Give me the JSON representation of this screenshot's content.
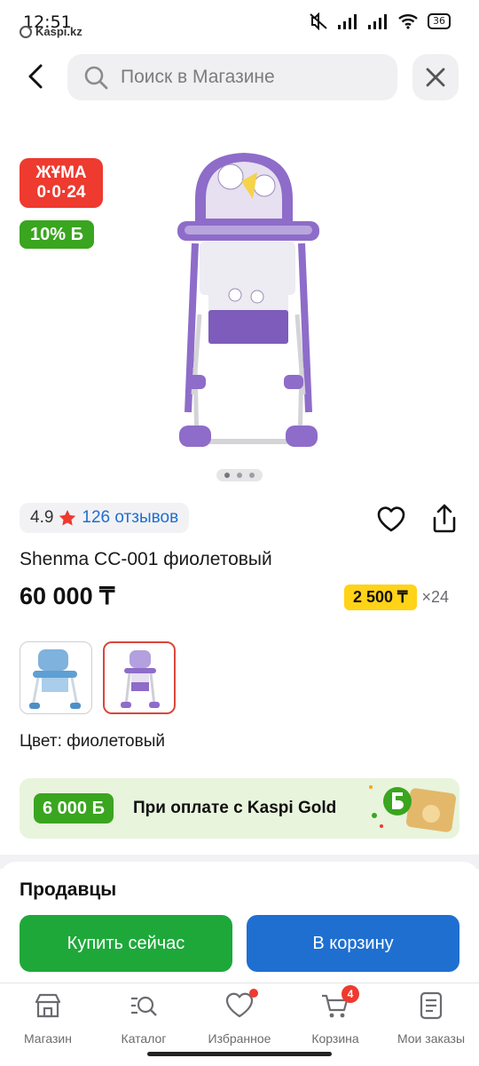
{
  "status_bar": {
    "time": "12:51",
    "app_label": "Kaspi.kz",
    "battery": "36"
  },
  "header": {
    "search_placeholder": "Поиск в Магазине",
    "icons": [
      "back-icon",
      "search-icon",
      "close-icon"
    ]
  },
  "gallery": {
    "sale_badge_line1": "ЖҰМА",
    "sale_badge_line2": "0·0·24",
    "bonus_badge": "10% Б",
    "slide_count": 3,
    "active_slide": 1
  },
  "product": {
    "rating": "4.9",
    "reviews": "126 отзывов",
    "title": "Shenma CC-001 фиолетовый",
    "price": "60 000 ₸",
    "installment_amount": "2 500 ₸",
    "installment_months": "×24",
    "color_label": "Цвет: фиолетовый",
    "variants": [
      {
        "name": "blue",
        "selected": false
      },
      {
        "name": "purple",
        "selected": true
      }
    ]
  },
  "gold_banner": {
    "amount": "6 000 Б",
    "text": "При оплате с Kaspi Gold"
  },
  "sellers": {
    "title": "Продавцы",
    "buy_now": "Купить сейчас",
    "add_to_cart": "В корзину"
  },
  "bottom_nav": {
    "items": [
      {
        "label": "Магазин",
        "icon": "shop-icon"
      },
      {
        "label": "Каталог",
        "icon": "catalog-search-icon"
      },
      {
        "label": "Избранное",
        "icon": "heart-icon"
      },
      {
        "label": "Корзина",
        "icon": "cart-icon",
        "badge": "4"
      },
      {
        "label": "Мои заказы",
        "icon": "orders-icon"
      }
    ]
  },
  "colors": {
    "accent_blue": "#1f6fd1",
    "buy_green": "#1ea83a",
    "sale_red": "#ee3a2f",
    "installment_yellow": "#ffd317",
    "bonus_green": "#3aa51f"
  }
}
